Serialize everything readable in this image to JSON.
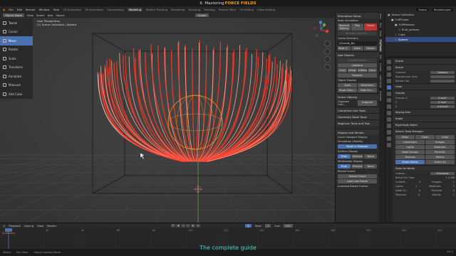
{
  "title_bar": {
    "prefix": "6. Mastering",
    "highlight": "FORCE FIELDS",
    "suffix": ""
  },
  "menu": [
    "File",
    "Edit",
    "Render",
    "Window",
    "Help"
  ],
  "workspaces": [
    "2D Animation",
    "3D Animation",
    "Compositing",
    "Modeling",
    "Motion Tracking",
    "Rendering",
    "Scripting",
    "Shading",
    "Texture Paint",
    "UV Editing",
    "Video Editing"
  ],
  "active_workspace": "Modeling",
  "scene_field": "Scene",
  "viewlayer_field": "RenderLayer",
  "viewport": {
    "mode": "Object Mode",
    "menus": [
      "View",
      "Select",
      "Add",
      "Object"
    ],
    "transform": "Global",
    "info_line1": "User Perspective",
    "info_line2": "(1) Scene Collection | Sphere"
  },
  "tools": [
    "Tweak",
    "Cursor",
    "Move",
    "Rotate",
    "Scale",
    "Transform",
    "Annotate",
    "Measure",
    "Add Cube"
  ],
  "active_tool": "Move",
  "npanel": {
    "simulation_setup": "Simulation Setup",
    "base_simulation": "Base Simulation",
    "bake_buttons": [
      "Resume Baking",
      "Play",
      "Pause"
    ],
    "resume_from": "Resume from fin...",
    "cache_directory": "Cache Directory",
    "cache_path": "//Gravity_Bo..",
    "bake_row": [
      "Bake C...",
      "Bake",
      "Delete"
    ],
    "add_objects": "Add Objects",
    "create_emitter": "Create Emitter",
    "obstacle": "Obstacle",
    "obstacle_types": [
      "Fluid",
      "Inflow",
      "Outflow",
      "Force"
    ],
    "remove": "Remove",
    "object_display": "Object Display",
    "display_row1": [
      "Solid",
      "Wireframe"
    ],
    "display_row2": [
      "Show Simu...",
      "Hide Sim..."
    ],
    "sections": [
      "Select Objects",
      "Organize Outl...",
      "Command Line Tools",
      "Geometry Node Tools",
      "Beginner Tools and Tips"
    ],
    "organize_btn": "Organize",
    "display_render": "Display and Render",
    "quick_viewport": "Quick Viewport Display",
    "sim_visibility": "Simulation Visibility",
    "show_in_viewport": "Show in Viewport",
    "surface_display": "Surface Display",
    "surface_opts": [
      "Final",
      "Preview",
      "None"
    ],
    "whitewater_display": "Whitewater Display",
    "whitewater_opts": [
      "Final",
      "Preview",
      "None"
    ],
    "reload_frame": "Reload Frame",
    "reload_btn": "Reload Frame",
    "load_last": "Load Last Frame",
    "autoload": "Autoload Baked Frames"
  },
  "vtabs": [
    "Item",
    "Tool",
    "View",
    "FlipFluids",
    "Edit",
    "Create",
    "LumiCloud",
    "Animate"
  ],
  "outliner": {
    "rows": [
      {
        "label": "Scene Collection",
        "indent": 0,
        "selected": false
      },
      {
        "label": "FLIPFluids",
        "indent": 1,
        "selected": false
      },
      {
        "label": "FLIPMeshes",
        "indent": 2,
        "selected": false
      },
      {
        "label": "fluid_surface",
        "indent": 3,
        "selected": false
      },
      {
        "label": "Cube",
        "indent": 2,
        "selected": false
      },
      {
        "label": "Sphere",
        "indent": 2,
        "selected": true
      }
    ]
  },
  "properties": {
    "scene_name": "Scene",
    "scene_section": "Scene",
    "camera_label": "Camera",
    "camera_value": "Camera",
    "background_label": "Background Scen",
    "active_clip_label": "Active Clip",
    "units": "Units",
    "gravity": "Gravity",
    "gravity_label": "Gravity X",
    "gravity_values": [
      "0 m/s²",
      "0 m/s²",
      "-9.8 m/s²"
    ],
    "axis_labels": [
      "X",
      "Y",
      "Z"
    ],
    "keying_sets": "Keying Sets",
    "audio": "Audio",
    "rigid_body": "Rigid Body World",
    "atomic": "Atomic Data Manager",
    "atomic_buttons": [
      "Nuke",
      "Clean",
      "Undo"
    ],
    "atomic_grid": [
      [
        "Collections",
        "Images"
      ],
      [
        "Lights",
        "Materials"
      ],
      [
        "Node Groups",
        "Particles"
      ],
      [
        "Textures",
        "Worlds"
      ]
    ],
    "smart_select": "Smart Select",
    "select_all": "Select All",
    "stats_title": "Stats for Nerds",
    "category_label": "Catego...",
    "overview": "Overview",
    "blend_file_size_label": "Blend File Size:",
    "blend_file_size": "1.4 MB",
    "stats": [
      {
        "k": "Collecti...",
        "v": "4",
        "k2": "Images",
        "v2": "1"
      },
      {
        "k": "Lights",
        "v": "1",
        "k2": "Materials",
        "v2": "2"
      },
      {
        "k": "Node Gr...",
        "v": "0",
        "k2": "Particles",
        "v2": "0"
      },
      {
        "k": "Textures",
        "v": "0",
        "k2": "Worlds",
        "v2": "1"
      }
    ]
  },
  "timeline": {
    "menus": [
      "Playback",
      "Keying",
      "View",
      "Marker"
    ],
    "start_label": "Start",
    "start": "1",
    "end_label": "End",
    "end": "250",
    "current": "1",
    "ticks": [
      "0",
      "20",
      "40",
      "60",
      "80",
      "100",
      "120",
      "140",
      "160",
      "180",
      "200",
      "220",
      "240"
    ],
    "summary": "Summary"
  },
  "status": [
    "Select",
    "Pan View",
    "Object Context Menu"
  ],
  "version": "3.6.0",
  "caption": "The complete guide",
  "colors": {
    "accent": "#4a72b3",
    "strands": "#ff3a24",
    "strands_light": "#ffb0a0",
    "caption": "#3fd7c4",
    "title_highlight": "#f0a020"
  }
}
